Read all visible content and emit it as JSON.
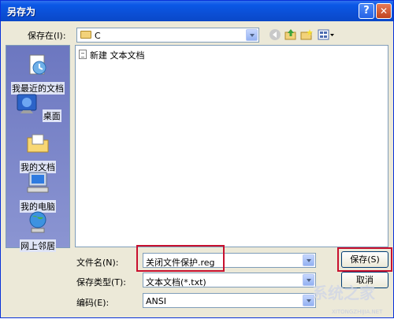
{
  "window": {
    "title": "另存为",
    "help": "?",
    "close": "✕"
  },
  "save_in": {
    "label": "保存在(I):",
    "value": "C"
  },
  "places": [
    {
      "label": "我最近的文档"
    },
    {
      "label": "桌面"
    },
    {
      "label": "我的文档"
    },
    {
      "label": "我的电脑"
    },
    {
      "label": "网上邻居"
    }
  ],
  "files": [
    {
      "name": "新建 文本文档"
    }
  ],
  "filename": {
    "label": "文件名(N):",
    "value": "关闭文件保护.reg"
  },
  "filetype": {
    "label": "保存类型(T):",
    "value": "文本文档(*.txt)"
  },
  "encoding": {
    "label": "编码(E):",
    "value": "ANSI"
  },
  "buttons": {
    "save": "保存(S)",
    "cancel": "取消"
  },
  "watermark": {
    "brand": "系统之家",
    "url": "XITONGZHIJIA.NET"
  },
  "colors": {
    "titlebar": "#0b4fd6",
    "dialog_bg": "#ece9d8",
    "highlight": "#c8102e",
    "places_bg": "#7c88c9"
  }
}
